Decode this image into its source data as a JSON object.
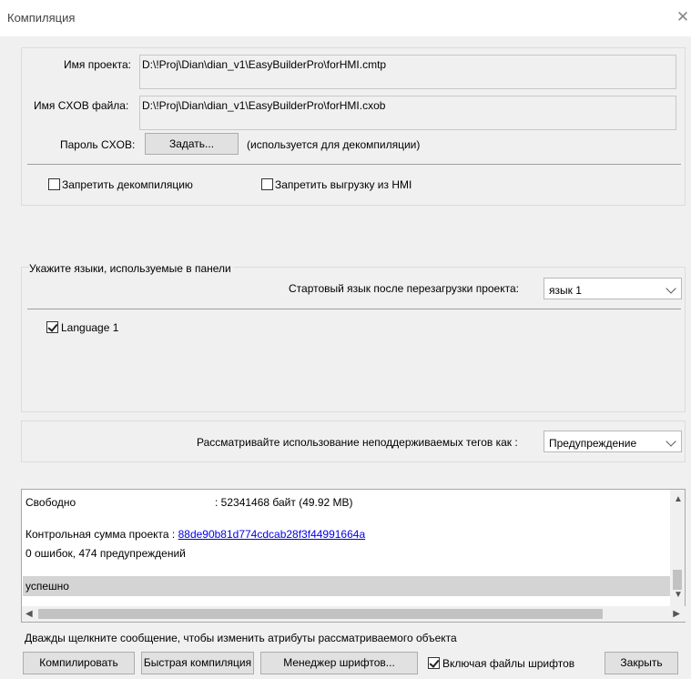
{
  "window": {
    "title": "Компиляция",
    "close_glyph": "✕"
  },
  "project": {
    "name_label": "Имя проекта:",
    "name_value": "D:\\!Proj\\Dian\\dian_v1\\EasyBuilderPro\\forHMI.cmtp",
    "cxob_label": "Имя CXOB файла:",
    "cxob_value": "D:\\!Proj\\Dian\\dian_v1\\EasyBuilderPro\\forHMI.cxob",
    "password_label": "Пароль CXOB:",
    "password_button": "Задать...",
    "password_note": "(используется для декомпиляции)",
    "forbid_decompile": {
      "label": "Запретить декомпиляцию",
      "checked": false
    },
    "forbid_upload": {
      "label": "Запретить выгрузку из HMI",
      "checked": false
    }
  },
  "languages": {
    "group_title": "Укажите языки, используемые в панели",
    "startup_label": "Стартовый язык после перезагрузки проекта:",
    "startup_value": "язык 1",
    "items": [
      {
        "label": "Language 1",
        "checked": true
      }
    ]
  },
  "tags": {
    "label": "Рассматривайте использование неподдерживаемых тегов как :",
    "value": "Предупреждение"
  },
  "log": {
    "free_label": "Свободно",
    "free_value": ":  52341468 байт (49.92 MB)",
    "checksum_label": "Контрольная сумма проекта :",
    "checksum_value": "88de90b81d774cdcab28f3f44991664a",
    "errors": "0 ошибок, 474 предупреждений",
    "status": "успешно"
  },
  "hint": "Дважды щелкните сообщение, чтобы изменить атрибуты рассматриваемого объекта",
  "footer": {
    "compile": "Компилировать",
    "quick_compile": "Быстрая компиляция",
    "font_manager": "Менеджер шрифтов...",
    "include_fonts": {
      "label": "Включая файлы шрифтов",
      "checked": true
    },
    "close": "Закрыть"
  },
  "icons": {
    "close": "close-icon",
    "chevron": "chevron-down-icon"
  }
}
